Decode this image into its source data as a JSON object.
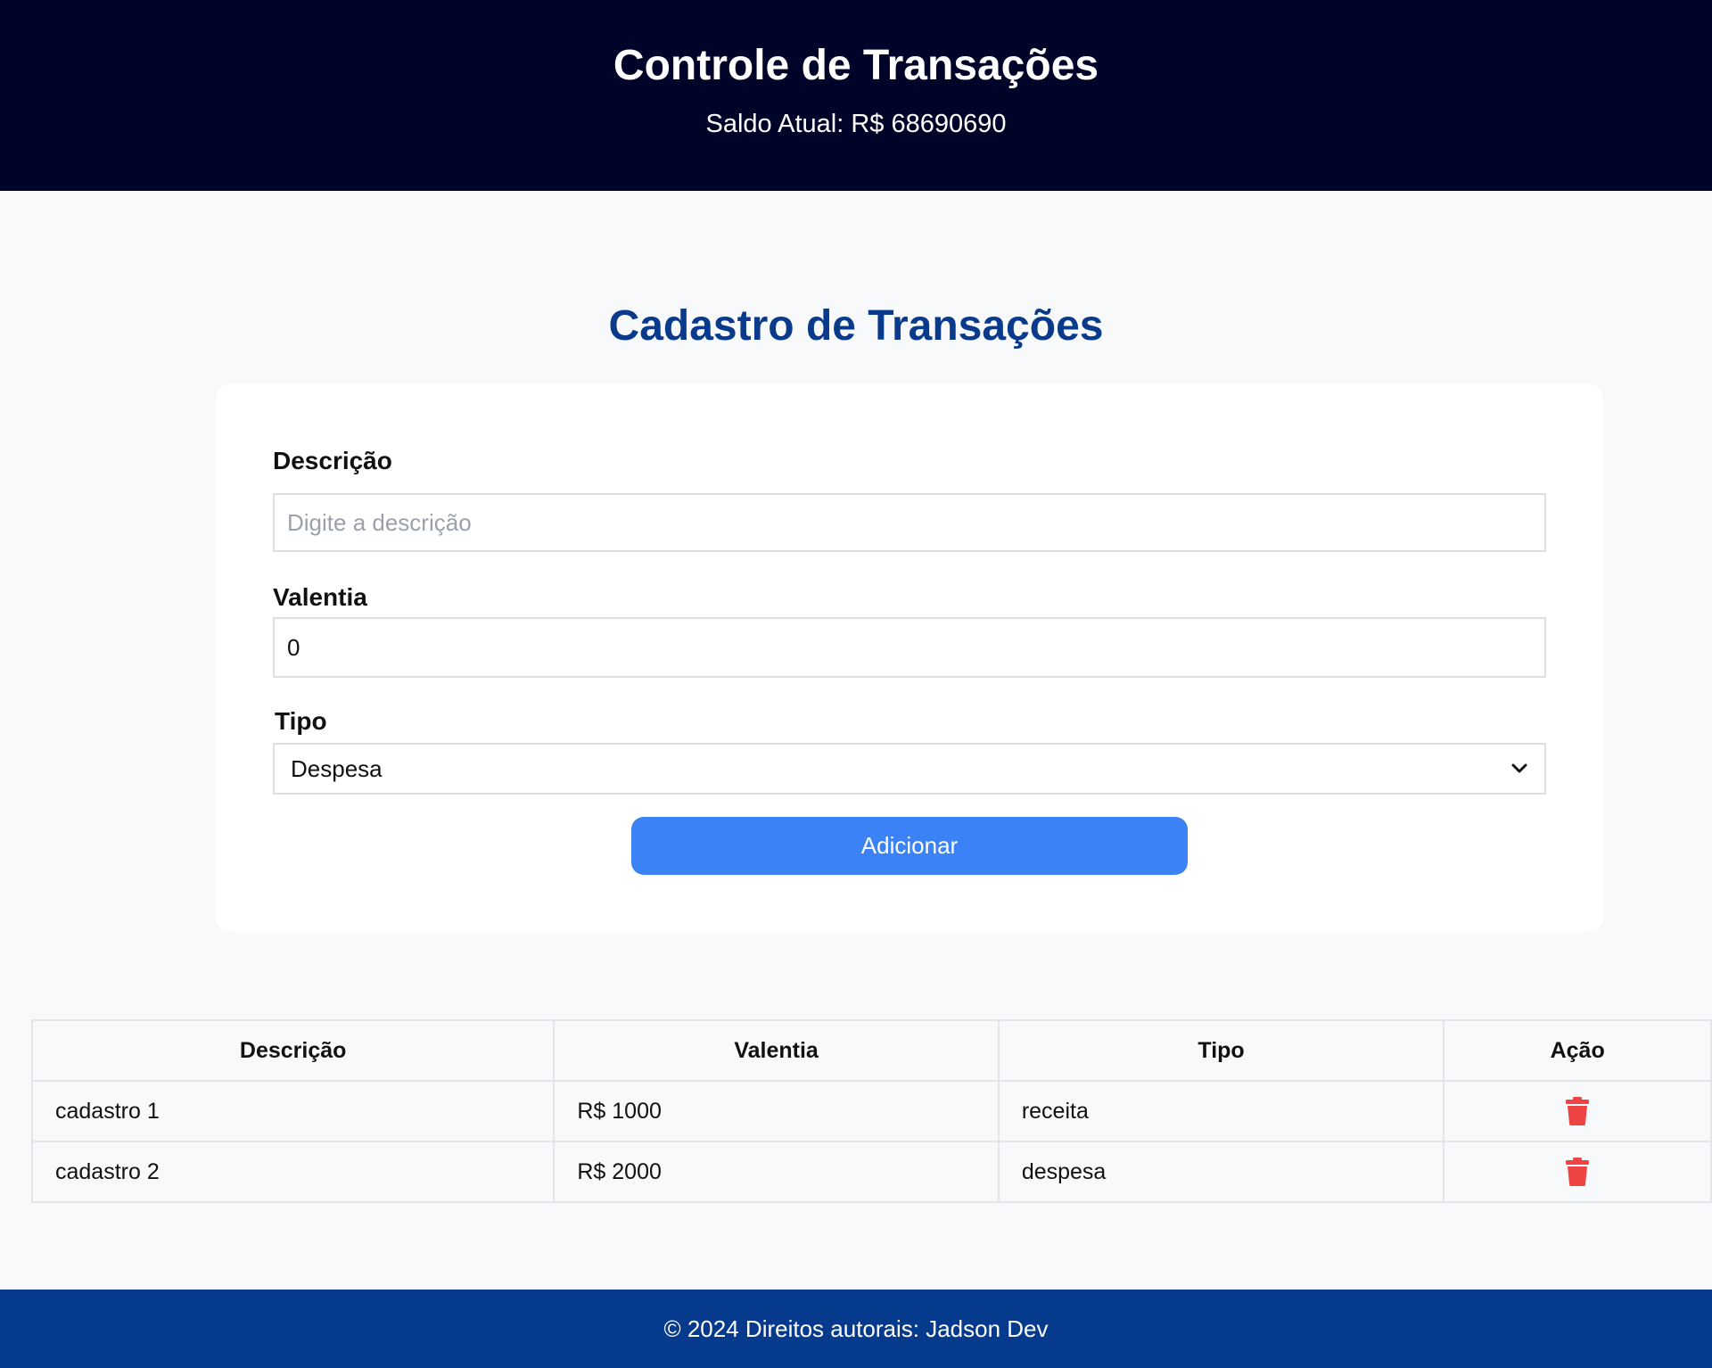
{
  "header": {
    "title": "Controle de Transações",
    "balance": "Saldo Atual: R$ 68690690"
  },
  "form": {
    "title": "Cadastro de Transações",
    "description_label": "Descrição",
    "description_placeholder": "Digite a descrição",
    "description_value": "",
    "value_label": "Valentia",
    "value_value": "0",
    "type_label": "Tipo",
    "type_selected": "Despesa",
    "submit_label": "Adicionar"
  },
  "table": {
    "headers": [
      "Descrição",
      "Valentia",
      "Tipo",
      "Ação"
    ],
    "rows": [
      {
        "description": "cadastro 1",
        "value": "R$ 1000",
        "type": "receita",
        "action_icon": "trash-icon"
      },
      {
        "description": "cadastro 2",
        "value": "R$ 2000",
        "type": "despesa",
        "action_icon": "trash-icon"
      }
    ]
  },
  "footer": {
    "text": "© 2024 Direitos autorais: Jadson Dev"
  },
  "colors": {
    "header_bg": "#000428",
    "title_blue": "#0a3a8c",
    "button_blue": "#3b82f6",
    "footer_bg": "#063a8c",
    "delete_red": "#ef4444"
  }
}
